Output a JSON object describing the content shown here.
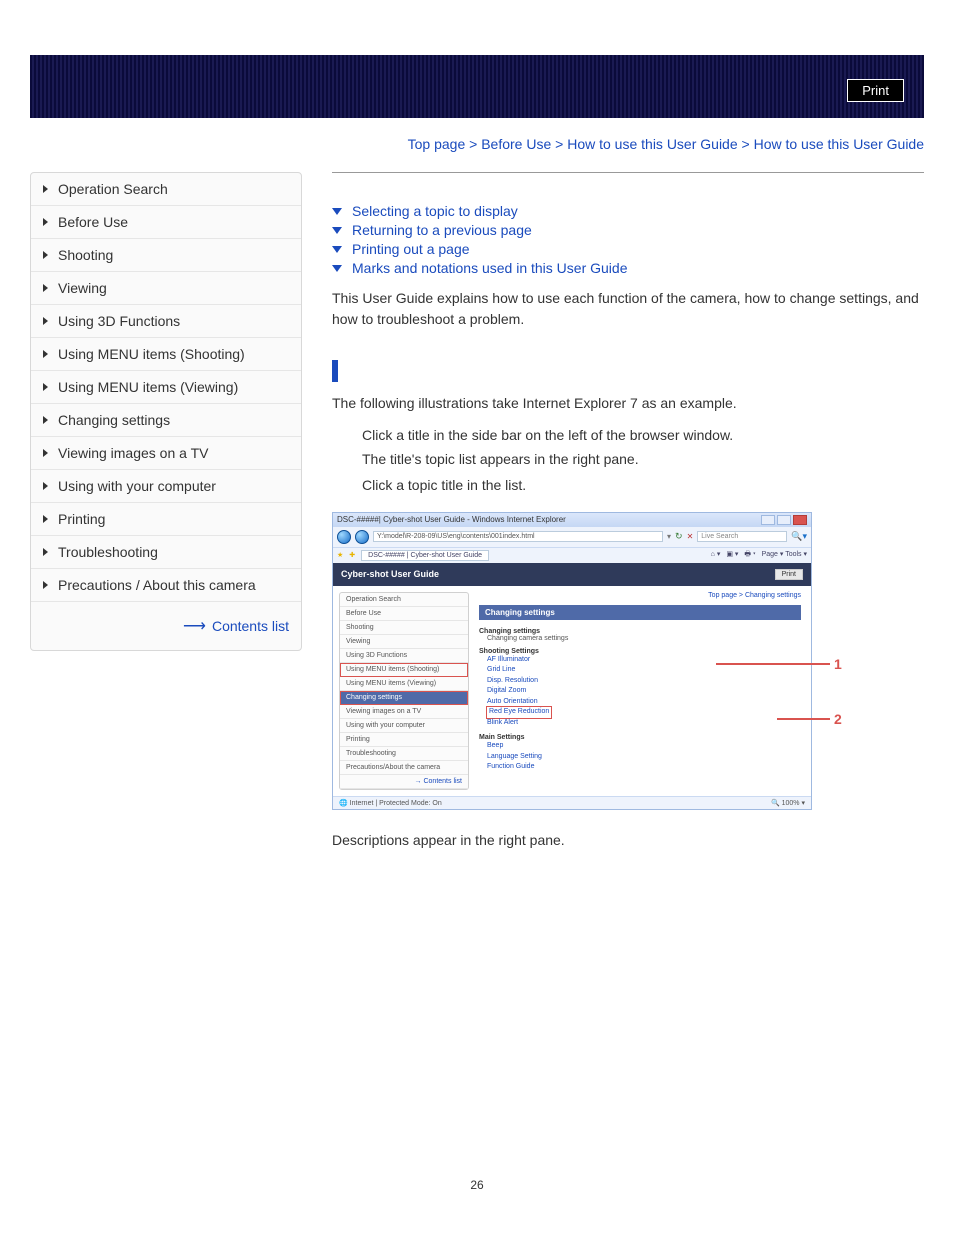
{
  "header": {
    "print_label": "Print"
  },
  "breadcrumb": {
    "items": [
      "Top page",
      "Before Use",
      "How to use this User Guide",
      "How to use this User Guide"
    ],
    "sep": " > "
  },
  "sidebar": {
    "items": [
      {
        "label": "Operation Search"
      },
      {
        "label": "Before Use"
      },
      {
        "label": "Shooting"
      },
      {
        "label": "Viewing"
      },
      {
        "label": "Using 3D Functions"
      },
      {
        "label": "Using MENU items (Shooting)"
      },
      {
        "label": "Using MENU items (Viewing)"
      },
      {
        "label": "Changing settings"
      },
      {
        "label": "Viewing images on a TV"
      },
      {
        "label": "Using with your computer"
      },
      {
        "label": "Printing"
      },
      {
        "label": "Troubleshooting"
      },
      {
        "label": "Precautions / About this camera"
      }
    ],
    "contents_label": "Contents list"
  },
  "anchors": {
    "items": [
      "Selecting a topic to display",
      "Returning to a previous page",
      "Printing out a page",
      "Marks and notations used in this User Guide"
    ]
  },
  "intro": "This User Guide explains how to use each function of the camera, how to change settings, and how to troubleshoot a problem.",
  "section": {
    "lead": "The following illustrations take Internet Explorer 7 as an example.",
    "step1a": "Click a title in the side bar on the left of the browser window.",
    "step1b": "The title's topic list appears in the right pane.",
    "step2": "Click a topic title in the list.",
    "desc_after": "Descriptions appear in the right pane."
  },
  "ie": {
    "title": "DSC-#####| Cyber-shot User Guide - Windows Internet Explorer",
    "address": "Y:\\model\\R-208-09\\US\\eng\\contents\\001index.html",
    "search_placeholder": "Live Search",
    "tab_label": "DSC-##### | Cyber-shot User Guide",
    "tool_items": "Page ▾   Tools ▾",
    "guide_title": "Cyber-shot User Guide",
    "print_btn": "Print",
    "cs_breadcrumb": "Top page > Changing settings",
    "side_items": [
      "Operation Search",
      "Before Use",
      "Shooting",
      "Viewing",
      "Using 3D Functions",
      "Using MENU items (Shooting)",
      "Using MENU items (Viewing)",
      "Changing settings",
      "Viewing images on a TV",
      "Using with your computer",
      "Printing",
      "Troubleshooting",
      "Precautions/About the camera"
    ],
    "contents_list": "→ Contents list",
    "main_title": "Changing settings",
    "sec1_h": "Changing settings",
    "sec1_sub": "Changing camera settings",
    "sec2_h": "Shooting Settings",
    "sec2_links": [
      "AF Illuminator",
      "Grid Line",
      "Disp. Resolution",
      "Digital Zoom",
      "Auto Orientation",
      "Red Eye Reduction",
      "Blink Alert"
    ],
    "sec3_h": "Main Settings",
    "sec3_links": [
      "Beep",
      "Language Setting",
      "Function Guide"
    ],
    "status_left": "Internet | Protected Mode: On",
    "status_right": "100%  ▾"
  },
  "callouts": {
    "c1": "1",
    "c2": "2"
  },
  "page_number": "26"
}
